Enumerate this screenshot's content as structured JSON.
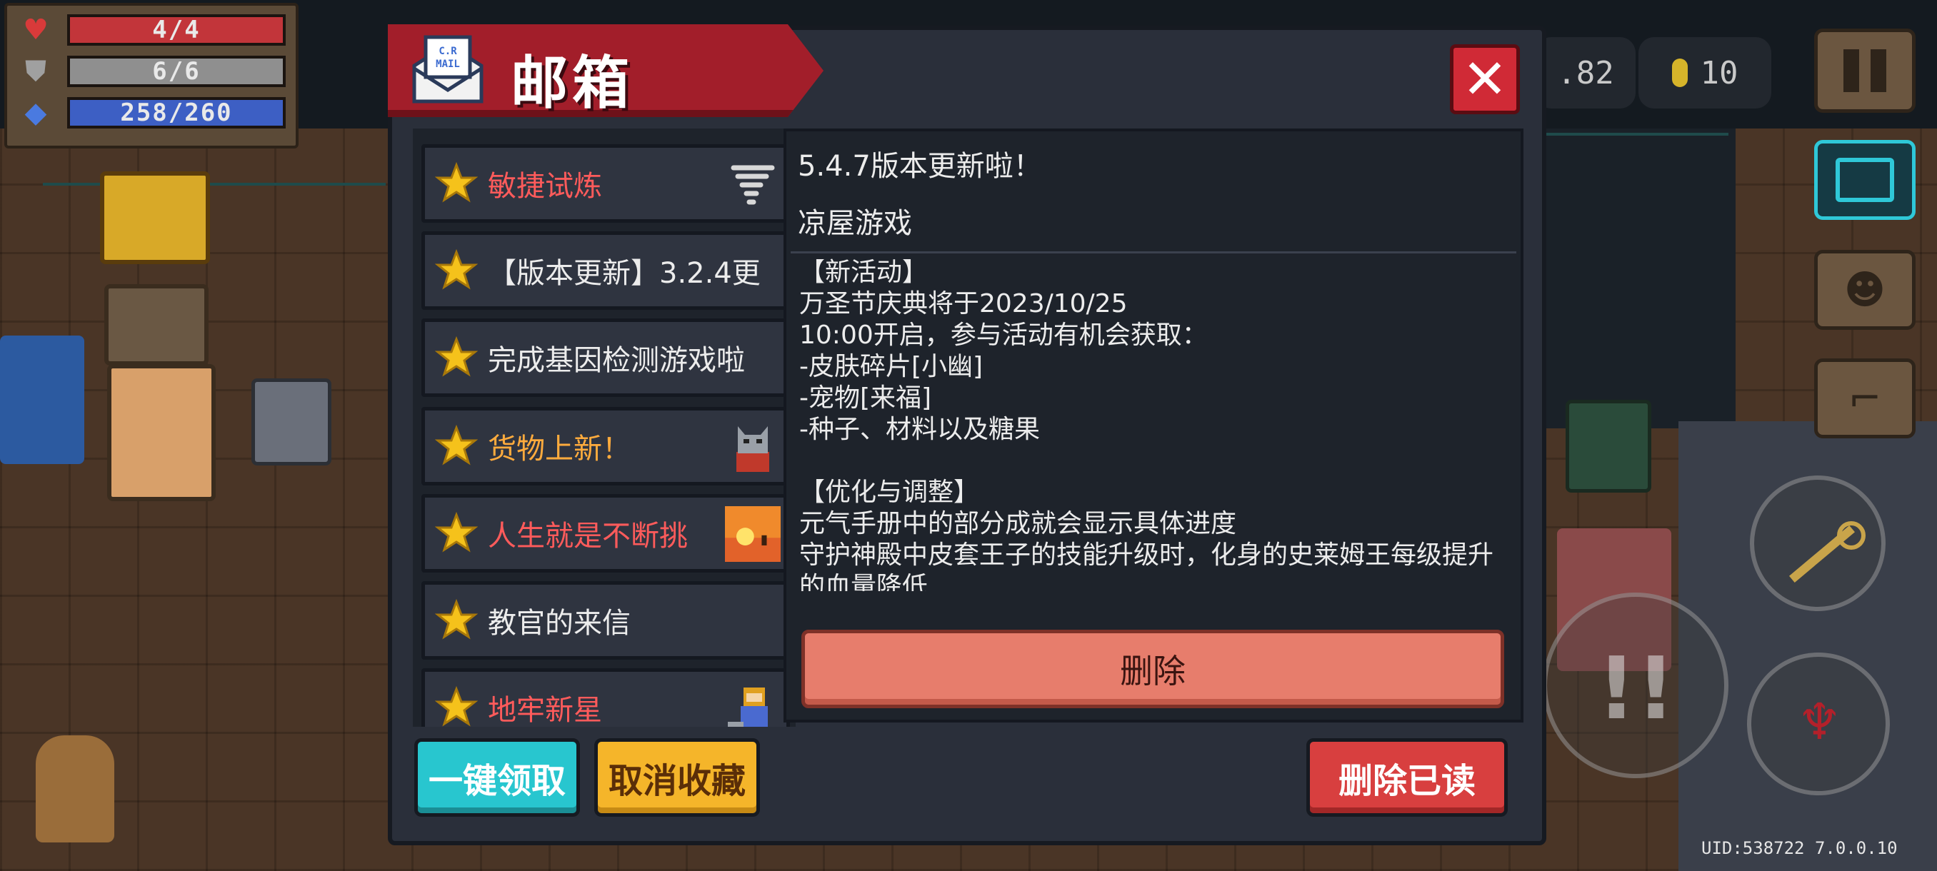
{
  "hud": {
    "hp": "4/4",
    "armor": "6/6",
    "energy": "258/260",
    "hp_icon": "heart-icon",
    "armor_icon": "shield-icon",
    "energy_icon": "diamond-icon"
  },
  "top_right": {
    "gems_partial": ".82",
    "coins": "10",
    "coin_icon": "coin-icon",
    "pause_icon": "pause-icon"
  },
  "mailbox": {
    "title": "邮箱",
    "icon_text": "MAIL",
    "close_icon": "close-icon",
    "items": [
      {
        "label": "敏捷试炼",
        "color": "#ff5b5b",
        "thumb": "tornado-icon"
      },
      {
        "label": "【版本更新】3.2.4更",
        "color": "#ececec",
        "thumb": ""
      },
      {
        "label": "完成基因检测游戏啦",
        "color": "#ececec",
        "thumb": ""
      },
      {
        "label": "货物上新！",
        "color": "#ffab3d",
        "thumb": "cat-icon"
      },
      {
        "label": "人生就是不断挑",
        "color": "#ff5b5b",
        "thumb": "sunset-icon"
      },
      {
        "label": "教官的来信",
        "color": "#ececec",
        "thumb": ""
      },
      {
        "label": "地牢新星",
        "color": "#ff5b5b",
        "thumb": "character-icon"
      }
    ],
    "mail_title": "5.4.7版本更新啦！",
    "mail_sender": "凉屋游戏",
    "mail_body": "【新活动】\n万圣节庆典将于2023/10/25\n10:00开启，参与活动有机会获取：\n-皮肤碎片[小幽]\n-宠物[来福]\n-种子、材料以及糖果\n\n【优化与调整】\n元气手册中的部分成就会显示具体进度\n守护神殿中皮套王子的技能升级时，化身的史莱姆王每级提升的血量降低",
    "delete_label": "删除",
    "claim_all_label": "一键领取",
    "unfavorite_label": "取消收藏",
    "delete_read_label": "删除已读"
  },
  "footer": {
    "uid": "UID:538722 7.0.0.10"
  },
  "colors": {
    "banner": "#a21e2a",
    "claim": "#28c6cf",
    "unfavorite": "#f5b52a",
    "delete_read": "#d83f3f",
    "delete": "#e77d6c"
  }
}
